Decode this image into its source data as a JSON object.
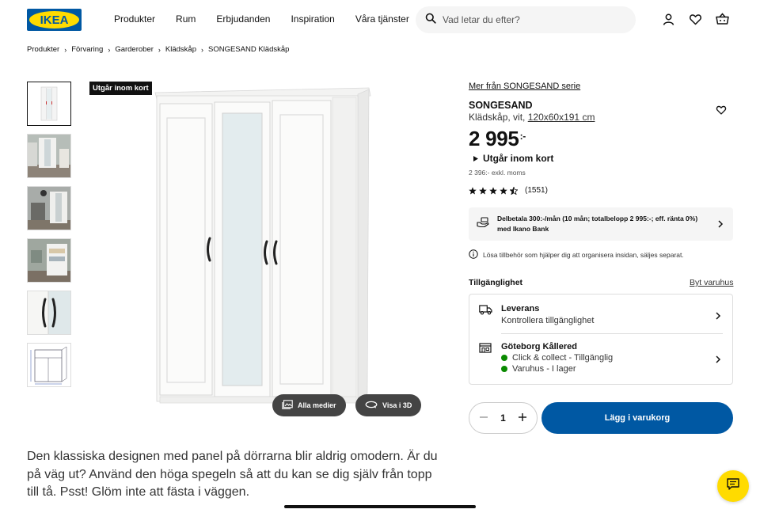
{
  "header": {
    "logo_text": "IKEA",
    "nav": [
      "Produkter",
      "Rum",
      "Erbjudanden",
      "Inspiration",
      "Våra tjänster"
    ],
    "search_placeholder": "Vad letar du efter?",
    "icons": [
      "user-icon",
      "heart-icon",
      "cart-icon"
    ]
  },
  "breadcrumb": [
    "Produkter",
    "Förvaring",
    "Garderober",
    "Klädskåp",
    "SONGESAND Klädskåp"
  ],
  "gallery": {
    "badge": "Utgår inom kort",
    "all_media": "Alla medier",
    "view_3d": "Visa i 3D",
    "thumbnail_count": 6
  },
  "product": {
    "series_link": "Mer från SONGESAND serie",
    "name": "SONGESAND",
    "description_prefix": "Klädskåp, vit,",
    "dimensions": "120x60x191 cm",
    "price": "2 995",
    "price_suffix": ":-",
    "expiring": "Utgår inom kort",
    "price_excl_vat": "2 396:- exkl. moms",
    "rating_stars": 4.5,
    "rating_count": "(1551)",
    "finance_text": "Delbetala 300:-/mån (10 mån; totalbelopp 2 995:-; eff. ränta 0%) med Ikano Bank",
    "info_text": "Lösa tillbehör som hjälper dig att organisera insidan, säljes separat."
  },
  "availability": {
    "title": "Tillgänglighet",
    "change_store": "Byt varuhus",
    "delivery_title": "Leverans",
    "delivery_sub": "Kontrollera tillgänglighet",
    "store_title": "Göteborg Kållered",
    "store_click": "Click & collect - Tillgänglig",
    "store_stock": "Varuhus - I lager",
    "status_color": "#0a8a00"
  },
  "purchase": {
    "quantity": "1",
    "add_to_cart": "Lägg i varukorg"
  },
  "description": "Den klassiska designen med panel på dörrarna blir aldrig omodern. Är du på väg ut? Använd den höga spegeln så att du kan se dig själv från topp till tå. Psst! Glöm inte att fästa i väggen.",
  "colors": {
    "brand_blue": "#0058a3",
    "brand_yellow": "#ffdb00"
  }
}
